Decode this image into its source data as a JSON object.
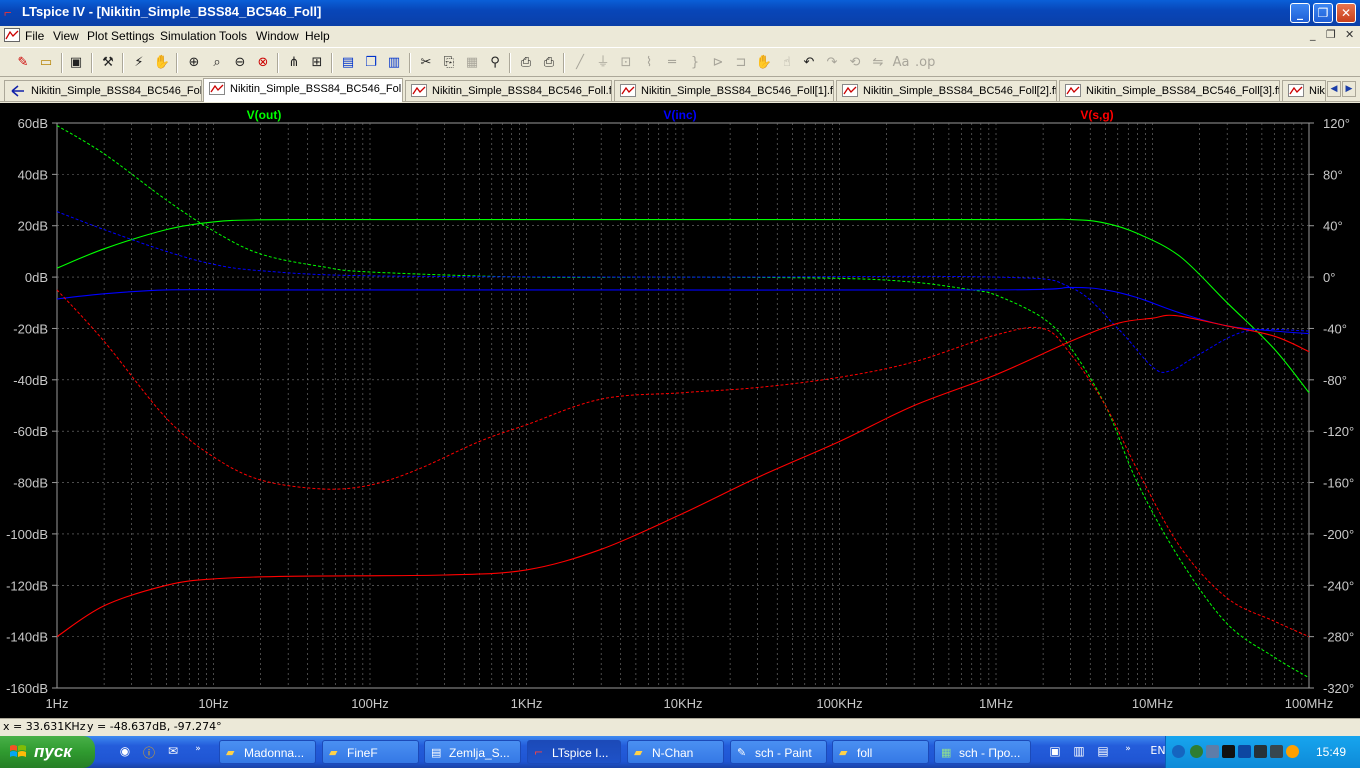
{
  "window": {
    "title": "LTspice IV - [Nikitin_Simple_BSS84_BC546_Foll]",
    "controls": [
      "_",
      "❐",
      "✕"
    ]
  },
  "menu": {
    "items": [
      "File",
      "View",
      "Plot Settings",
      "Simulation",
      "Tools",
      "Window",
      "Help"
    ],
    "mdi_controls": [
      "_",
      "❐",
      "✕"
    ]
  },
  "tabs": [
    {
      "label": "Nikitin_Simple_BSS84_BC546_Foll",
      "kind": "schematic"
    },
    {
      "label": "Nikitin_Simple_BSS84_BC546_Foll",
      "kind": "plot",
      "active": true
    },
    {
      "label": "Nikitin_Simple_BSS84_BC546_Foll.fft",
      "kind": "plot"
    },
    {
      "label": "Nikitin_Simple_BSS84_BC546_Foll[1].fft",
      "kind": "plot"
    },
    {
      "label": "Nikitin_Simple_BSS84_BC546_Foll[2].fft",
      "kind": "plot"
    },
    {
      "label": "Nikitin_Simple_BSS84_BC546_Foll[3].fft",
      "kind": "plot"
    },
    {
      "label": "Nik",
      "kind": "plot"
    }
  ],
  "status": {
    "x": "x = 33.631KHz",
    "y": "y = -48.637dB, -97.274°"
  },
  "taskbar": {
    "start": "пуск",
    "tasks": [
      {
        "label": "Madonna...",
        "icon": "folder-icon"
      },
      {
        "label": "FineF",
        "icon": "folder-icon"
      },
      {
        "label": "Zemlja_S...",
        "icon": "document-icon"
      },
      {
        "label": "LTspice I...",
        "icon": "ltspice-icon",
        "active": true
      },
      {
        "label": "N-Chan",
        "icon": "folder-icon"
      },
      {
        "label": "sch - Paint",
        "icon": "paint-icon"
      },
      {
        "label": "foll",
        "icon": "folder-icon"
      },
      {
        "label": "sch - Про...",
        "icon": "image-viewer-icon"
      }
    ],
    "lang": "EN",
    "clock": "15:49"
  },
  "chart_data": {
    "type": "line",
    "x_scale": "log",
    "xlim": [
      1,
      100000000
    ],
    "ylim_left": [
      -160,
      60
    ],
    "ylim_right": [
      -320,
      120
    ],
    "xticks": [
      {
        "v": 1,
        "label": "1Hz"
      },
      {
        "v": 10,
        "label": "10Hz"
      },
      {
        "v": 100,
        "label": "100Hz"
      },
      {
        "v": 1000,
        "label": "1KHz"
      },
      {
        "v": 10000,
        "label": "10KHz"
      },
      {
        "v": 100000,
        "label": "100KHz"
      },
      {
        "v": 1000000,
        "label": "1MHz"
      },
      {
        "v": 10000000,
        "label": "10MHz"
      },
      {
        "v": 100000000,
        "label": "100MHz"
      }
    ],
    "yticks_left": [
      {
        "v": 60,
        "label": "60dB"
      },
      {
        "v": 40,
        "label": "40dB"
      },
      {
        "v": 20,
        "label": "20dB"
      },
      {
        "v": 0,
        "label": "0dB"
      },
      {
        "v": -20,
        "label": "-20dB"
      },
      {
        "v": -40,
        "label": "-40dB"
      },
      {
        "v": -60,
        "label": "-60dB"
      },
      {
        "v": -80,
        "label": "-80dB"
      },
      {
        "v": -100,
        "label": "-100dB"
      },
      {
        "v": -120,
        "label": "-120dB"
      },
      {
        "v": -140,
        "label": "-140dB"
      },
      {
        "v": -160,
        "label": "-160dB"
      }
    ],
    "yticks_right": [
      {
        "v": 120,
        "label": "120°"
      },
      {
        "v": 80,
        "label": "80°"
      },
      {
        "v": 40,
        "label": "40°"
      },
      {
        "v": 0,
        "label": "0°"
      },
      {
        "v": -40,
        "label": "-40°"
      },
      {
        "v": -80,
        "label": "-80°"
      },
      {
        "v": -120,
        "label": "-120°"
      },
      {
        "v": -160,
        "label": "-160°"
      },
      {
        "v": -200,
        "label": "-200°"
      },
      {
        "v": -240,
        "label": "-240°"
      },
      {
        "v": -280,
        "label": "-280°"
      },
      {
        "v": -320,
        "label": "-320°"
      }
    ],
    "grid": true,
    "series": [
      {
        "name": "V(out)",
        "color": "#00ff00",
        "magnitude_db": [
          [
            1,
            3.5
          ],
          [
            2,
            11
          ],
          [
            5,
            18.5
          ],
          [
            10,
            21.5
          ],
          [
            20,
            22.3
          ],
          [
            100,
            22.4
          ],
          [
            1000,
            22.4
          ],
          [
            1000000,
            22.4
          ],
          [
            3000000,
            22.4
          ],
          [
            5000000,
            21
          ],
          [
            8000000,
            17
          ],
          [
            15000000,
            8
          ],
          [
            30000000,
            -10
          ],
          [
            60000000,
            -28
          ],
          [
            100000000,
            -45
          ]
        ],
        "phase_deg": [
          [
            1,
            118
          ],
          [
            2,
            96
          ],
          [
            5,
            60
          ],
          [
            10,
            36
          ],
          [
            20,
            18
          ],
          [
            50,
            8
          ],
          [
            100,
            4
          ],
          [
            1000,
            0
          ],
          [
            10000,
            0
          ],
          [
            100000,
            -1
          ],
          [
            300000,
            -4
          ],
          [
            700000,
            -10
          ],
          [
            1000000,
            -14
          ],
          [
            2000000,
            -32
          ],
          [
            3000000,
            -55
          ],
          [
            5000000,
            -100
          ],
          [
            8000000,
            -160
          ],
          [
            15000000,
            -220
          ],
          [
            30000000,
            -270
          ],
          [
            60000000,
            -296
          ],
          [
            100000000,
            -312
          ]
        ]
      },
      {
        "name": "V(inc)",
        "color": "#0000ff",
        "magnitude_db": [
          [
            1,
            -8.5
          ],
          [
            2,
            -6.5
          ],
          [
            5,
            -5
          ],
          [
            20,
            -5
          ],
          [
            1000,
            -5
          ],
          [
            1000000,
            -5
          ],
          [
            3000000,
            -4
          ],
          [
            5000000,
            -5
          ],
          [
            8000000,
            -8
          ],
          [
            15000000,
            -14
          ],
          [
            30000000,
            -19
          ],
          [
            60000000,
            -21
          ],
          [
            100000000,
            -22
          ]
        ],
        "phase_deg": [
          [
            1,
            51
          ],
          [
            2,
            37
          ],
          [
            5,
            20
          ],
          [
            10,
            10
          ],
          [
            20,
            5
          ],
          [
            100,
            1
          ],
          [
            10000,
            0
          ],
          [
            1000000,
            0
          ],
          [
            3000000,
            -8
          ],
          [
            6000000,
            -40
          ],
          [
            10000000,
            -70
          ],
          [
            13000000,
            -73
          ],
          [
            20000000,
            -60
          ],
          [
            40000000,
            -42
          ],
          [
            100000000,
            -42
          ]
        ]
      },
      {
        "name": "V(s,g)",
        "color": "#ff0000",
        "magnitude_db": [
          [
            1,
            -140
          ],
          [
            2,
            -128
          ],
          [
            5,
            -120
          ],
          [
            10,
            -117.5
          ],
          [
            30,
            -116.5
          ],
          [
            300,
            -116
          ],
          [
            1000,
            -114
          ],
          [
            3000,
            -106
          ],
          [
            10000,
            -92
          ],
          [
            30000,
            -78
          ],
          [
            100000,
            -64
          ],
          [
            300000,
            -50
          ],
          [
            1000000,
            -38
          ],
          [
            3000000,
            -25
          ],
          [
            6000000,
            -18
          ],
          [
            10000000,
            -16
          ],
          [
            14000000,
            -15
          ],
          [
            30000000,
            -19
          ],
          [
            60000000,
            -23
          ],
          [
            100000000,
            -29
          ]
        ],
        "phase_deg": [
          [
            1,
            -10
          ],
          [
            2,
            -50
          ],
          [
            5,
            -110
          ],
          [
            10,
            -140
          ],
          [
            20,
            -158
          ],
          [
            50,
            -165
          ],
          [
            100,
            -162
          ],
          [
            200,
            -150
          ],
          [
            500,
            -128
          ],
          [
            1000,
            -115
          ],
          [
            3000,
            -95
          ],
          [
            10000,
            -90
          ],
          [
            30000,
            -86
          ],
          [
            100000,
            -78
          ],
          [
            300000,
            -66
          ],
          [
            1000000,
            -45
          ],
          [
            2000000,
            -40
          ],
          [
            3000000,
            -60
          ],
          [
            5000000,
            -100
          ],
          [
            8000000,
            -150
          ],
          [
            15000000,
            -210
          ],
          [
            30000000,
            -250
          ],
          [
            60000000,
            -268
          ],
          [
            100000000,
            -280
          ]
        ]
      }
    ]
  }
}
